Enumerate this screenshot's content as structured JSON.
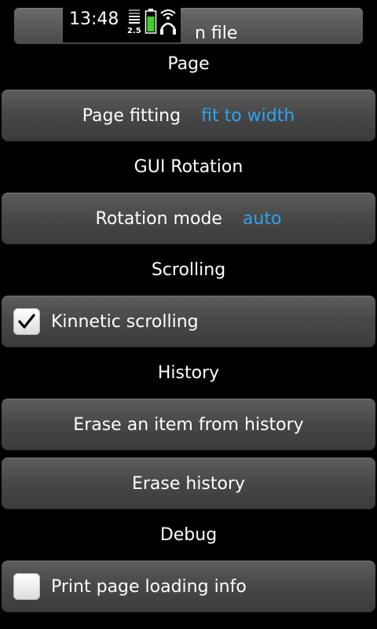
{
  "status_bar": {
    "time": "13:48",
    "network": "2.5"
  },
  "top_partial_button": {
    "label": "n file"
  },
  "sections": {
    "page": "Page",
    "gui_rotation": "GUI Rotation",
    "scrolling": "Scrolling",
    "history": "History",
    "debug": "Debug"
  },
  "page_fitting": {
    "label": "Page fitting",
    "value": "fit to width"
  },
  "rotation_mode": {
    "label": "Rotation mode",
    "value": "auto"
  },
  "kinnetic_scrolling": {
    "label": "Kinnetic scrolling",
    "checked": true
  },
  "erase_item": {
    "label": "Erase an item from history"
  },
  "erase_history": {
    "label": "Erase history"
  },
  "print_loading_info": {
    "label": "Print page loading info",
    "checked": false
  },
  "colors": {
    "accent": "#2ea3ef",
    "background": "#000000",
    "button": "#4a4a4a"
  },
  "icons": {
    "signal": "signal-bars-icon",
    "battery": "battery-icon",
    "wifi_headset": "wifi-headset-icon",
    "check": "checkmark-icon"
  }
}
